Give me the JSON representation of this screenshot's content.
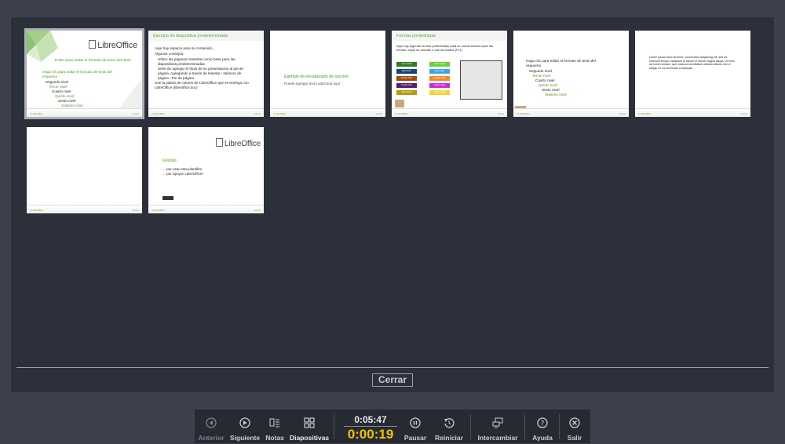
{
  "sorter": {
    "close_label": "Cerrar",
    "slides": [
      {
        "title": "Pulse para editar el formato de texto del título",
        "logo": "LibreOffice",
        "bullets": [
          "Haga clic para editar el formato de texto del esquema",
          "Segundo nivel",
          "Tercer nivel",
          "Cuarto nivel",
          "Quinto nivel",
          "Sexto nivel",
          "Séptimo nivel"
        ]
      },
      {
        "title": "Ejemplo de diapositiva predeterminada",
        "bullets": [
          "Aquí hay espacio para su contenido...",
          "Algunos consejos:",
          "Utilice las páginas maestras como base para las diapositivas predeterminadas",
          "Serie de agregar el título de su presentación al pie de página. Agregando a través de Insertar › Número de página › Pie de página",
          "Use la paleta de colores de LibreOffice que se entrega con LibreOffice (libreoffice.soc)"
        ]
      },
      {
        "title": "Ejemplo de encabezado de sección",
        "subtitle": "Puede agregar texto adicional aquí"
      },
      {
        "title": "Formas predefinidas",
        "intro": "Aquí hay algunas formas predefinidas para su conveniencia copie las formas, copie su formato o use los estilos (F11)",
        "shapes": [
          "Green Dark",
          "Green Light",
          "Blue Dark",
          "Blue Light",
          "Orange Dark",
          "Orange Light",
          "Purple Dark",
          "Purple Light",
          "Yellow Dark",
          "Yellow Light"
        ]
      },
      {
        "bullets": [
          "Haga clic para editar el formato de texto del esquema",
          "Segundo nivel",
          "Tercer nivel",
          "Cuarto nivel",
          "Quinto nivel",
          "Sexto nivel",
          "Séptimo nivel"
        ]
      },
      {
        "text": "Lorem ipsum dolor sit amet, consectetur adipiscing elit, sed do eiusmod tempor incididunt ut labore et dolore magna aliqua. Ut enim ad minim veniam, quis nostrud exercitation ullamco laboris nisi ut aliquip ex ea commodo consequat."
      },
      {},
      {
        "logo": "LibreOffice",
        "title": "Gracias",
        "lines": [
          "... por usar esta plantilla!",
          "... por apoyar LibreOffice!"
        ]
      }
    ]
  },
  "toolbar": {
    "previous": "Anterior",
    "next": "Siguiente",
    "notes": "Notas",
    "slides": "Diapositivas",
    "clock": "0:05:47",
    "elapsed": "0:00:19",
    "pause": "Pausar",
    "restart": "Reiniciar",
    "exchange": "Intercambiar",
    "help": "Ayuda",
    "exit": "Salir"
  },
  "colors": {
    "accent_green": "#3f9f1c",
    "timer": "#f2c200",
    "background": "#3d414c",
    "panel": "#2c303a"
  }
}
